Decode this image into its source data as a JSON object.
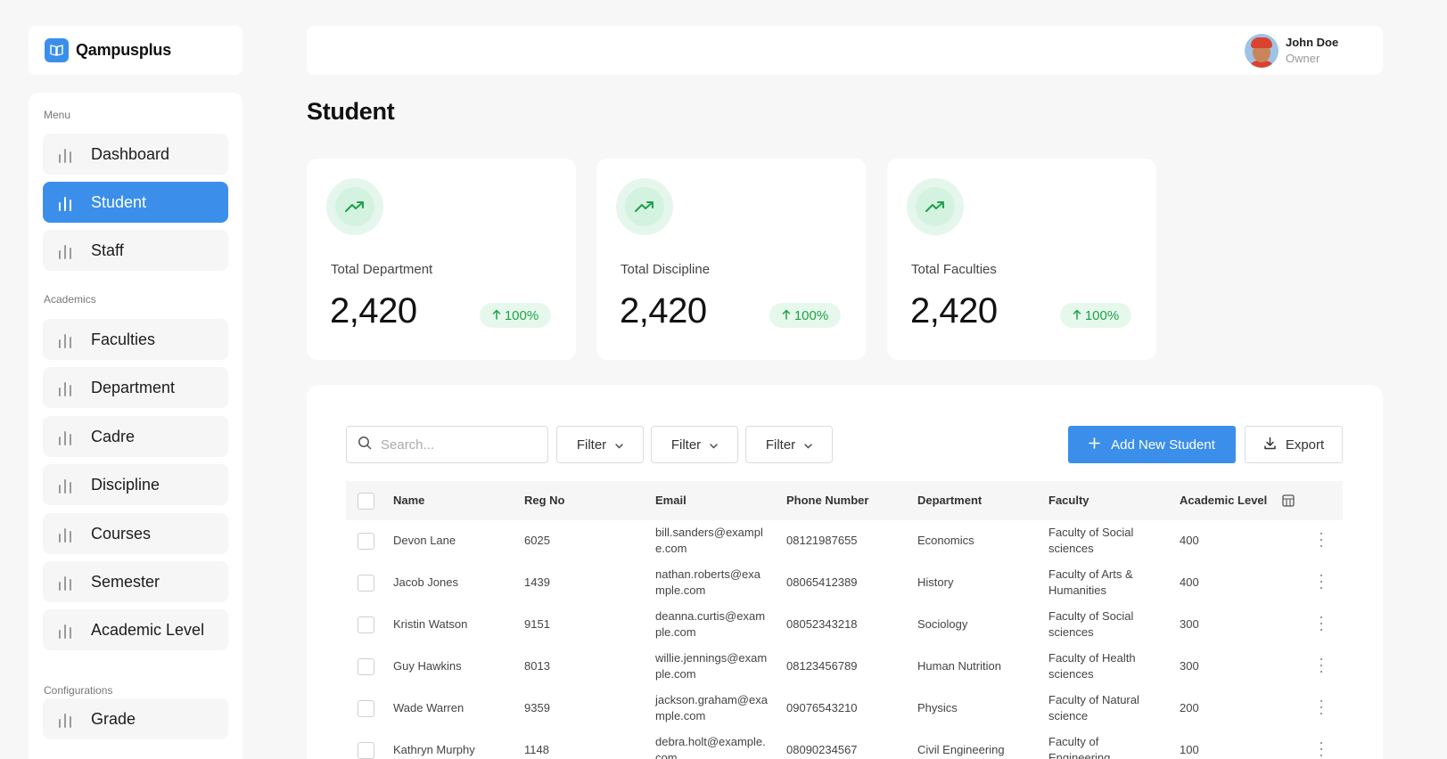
{
  "app": {
    "name": "Qampusplus"
  },
  "user": {
    "name": "John Doe",
    "role": "Owner"
  },
  "sidebar": {
    "sections": [
      {
        "title": "Menu",
        "items": [
          {
            "label": "Dashboard",
            "active": false
          },
          {
            "label": "Student",
            "active": true
          },
          {
            "label": "Staff",
            "active": false
          }
        ]
      },
      {
        "title": "Academics",
        "items": [
          {
            "label": "Faculties",
            "active": false
          },
          {
            "label": "Department",
            "active": false
          },
          {
            "label": "Cadre",
            "active": false
          },
          {
            "label": "Discipline",
            "active": false
          },
          {
            "label": "Courses",
            "active": false
          },
          {
            "label": "Semester",
            "active": false
          },
          {
            "label": "Academic Level",
            "active": false
          }
        ]
      },
      {
        "title": "Configurations",
        "items": [
          {
            "label": "Grade",
            "active": false
          }
        ]
      }
    ]
  },
  "page": {
    "title": "Student"
  },
  "stats": [
    {
      "label": "Total Department",
      "value": "2,420",
      "change": "100%"
    },
    {
      "label": "Total Discipline",
      "value": "2,420",
      "change": "100%"
    },
    {
      "label": "Total Faculties",
      "value": "2,420",
      "change": "100%"
    }
  ],
  "toolbar": {
    "search_placeholder": "Search...",
    "filters": [
      "Filter",
      "Filter",
      "Filter"
    ],
    "add_label": "Add New Student",
    "export_label": "Export"
  },
  "table": {
    "columns": [
      "Name",
      "Reg No",
      "Email",
      "Phone Number",
      "Department",
      "Faculty",
      "Academic Level"
    ],
    "rows": [
      {
        "name": "Devon Lane",
        "reg": "6025",
        "email": [
          "bill.sanders@exampl",
          "e.com"
        ],
        "phone": "08121987655",
        "dept": "Economics",
        "faculty": [
          "Faculty of Social",
          "sciences"
        ],
        "level": "400"
      },
      {
        "name": "Jacob Jones",
        "reg": "1439",
        "email": [
          "nathan.roberts@exa",
          "mple.com"
        ],
        "phone": "08065412389",
        "dept": "History",
        "faculty": [
          "Faculty of Arts &",
          "Humanities"
        ],
        "level": "400"
      },
      {
        "name": "Kristin Watson",
        "reg": "9151",
        "email": [
          "deanna.curtis@exam",
          "ple.com"
        ],
        "phone": "08052343218",
        "dept": "Sociology",
        "faculty": [
          "Faculty of Social",
          "sciences"
        ],
        "level": "300"
      },
      {
        "name": "Guy Hawkins",
        "reg": "8013",
        "email": [
          "willie.jennings@exam",
          "ple.com"
        ],
        "phone": "08123456789",
        "dept": "Human Nutrition",
        "faculty": [
          "Faculty of Health",
          "sciences"
        ],
        "level": "300"
      },
      {
        "name": "Wade Warren",
        "reg": "9359",
        "email": [
          "jackson.graham@exa",
          "mple.com"
        ],
        "phone": "09076543210",
        "dept": "Physics",
        "faculty": [
          "Faculty of Natural",
          "science"
        ],
        "level": "200"
      },
      {
        "name": "Kathryn Murphy",
        "reg": "1148",
        "email": [
          "debra.holt@example.",
          "com"
        ],
        "phone": "08090234567",
        "dept": "Civil Engineering",
        "faculty": [
          "Faculty of",
          "Engineering"
        ],
        "level": "100"
      }
    ]
  },
  "colors": {
    "accent": "#3b8fea",
    "positive": "#1fa14a",
    "positive_bg": "#e6f8ec"
  }
}
